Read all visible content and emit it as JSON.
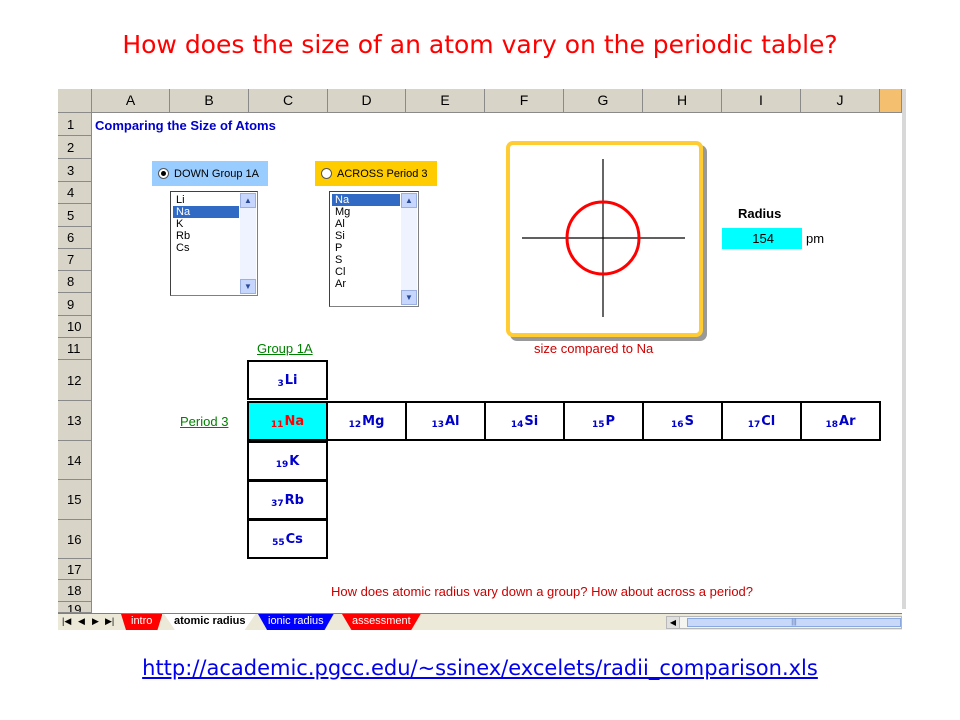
{
  "slide": {
    "title": "How does the size of an atom vary on the periodic table?",
    "url": "http://academic.pgcc.edu/~ssinex/excelets/radii_comparison.xls"
  },
  "sheet": {
    "columns": [
      "A",
      "B",
      "C",
      "D",
      "E",
      "F",
      "G",
      "H",
      "I",
      "J"
    ],
    "rows": [
      "1",
      "2",
      "3",
      "4",
      "5",
      "6",
      "7",
      "8",
      "9",
      "10",
      "11",
      "12",
      "13",
      "14",
      "15",
      "16",
      "17",
      "18",
      "19"
    ],
    "heading": "Comparing the Size of Atoms",
    "group_option": "DOWN Group 1A",
    "period_option": "ACROSS Period 3",
    "group_list": [
      "Li",
      "Na",
      "K",
      "Rb",
      "Cs"
    ],
    "group_selected": "Na",
    "period_list": [
      "Na",
      "Mg",
      "Al",
      "Si",
      "P",
      "S",
      "Cl",
      "Ar"
    ],
    "period_selected": "Na",
    "radius_label": "Radius",
    "radius_value": "154",
    "radius_unit": "pm",
    "compare_label": "size compared to Na",
    "group_label": "Group 1A",
    "period_label": "Period 3",
    "question": "How does atomic radius vary down a group?   How about across a period?",
    "tabs": [
      "intro",
      "atomic radius",
      "ionic radius",
      "assessment"
    ],
    "active_tab": "atomic radius"
  },
  "elements": {
    "li": {
      "num": "3",
      "sym": "Li"
    },
    "na": {
      "num": "11",
      "sym": "Na"
    },
    "mg": {
      "num": "12",
      "sym": "Mg"
    },
    "al": {
      "num": "13",
      "sym": "Al"
    },
    "si": {
      "num": "14",
      "sym": "Si"
    },
    "p": {
      "num": "15",
      "sym": "P"
    },
    "s": {
      "num": "16",
      "sym": "S"
    },
    "cl": {
      "num": "17",
      "sym": "Cl"
    },
    "ar": {
      "num": "18",
      "sym": "Ar"
    },
    "k": {
      "num": "19",
      "sym": "K"
    },
    "rb": {
      "num": "37",
      "sym": "Rb"
    },
    "cs": {
      "num": "55",
      "sym": "Cs"
    }
  },
  "colors": {
    "title": "#ff0000",
    "heading": "#0000cc",
    "highlight": "#00ffff",
    "frame": "#ffcc33",
    "circle": "#ff0000",
    "green_label": "#008000"
  }
}
